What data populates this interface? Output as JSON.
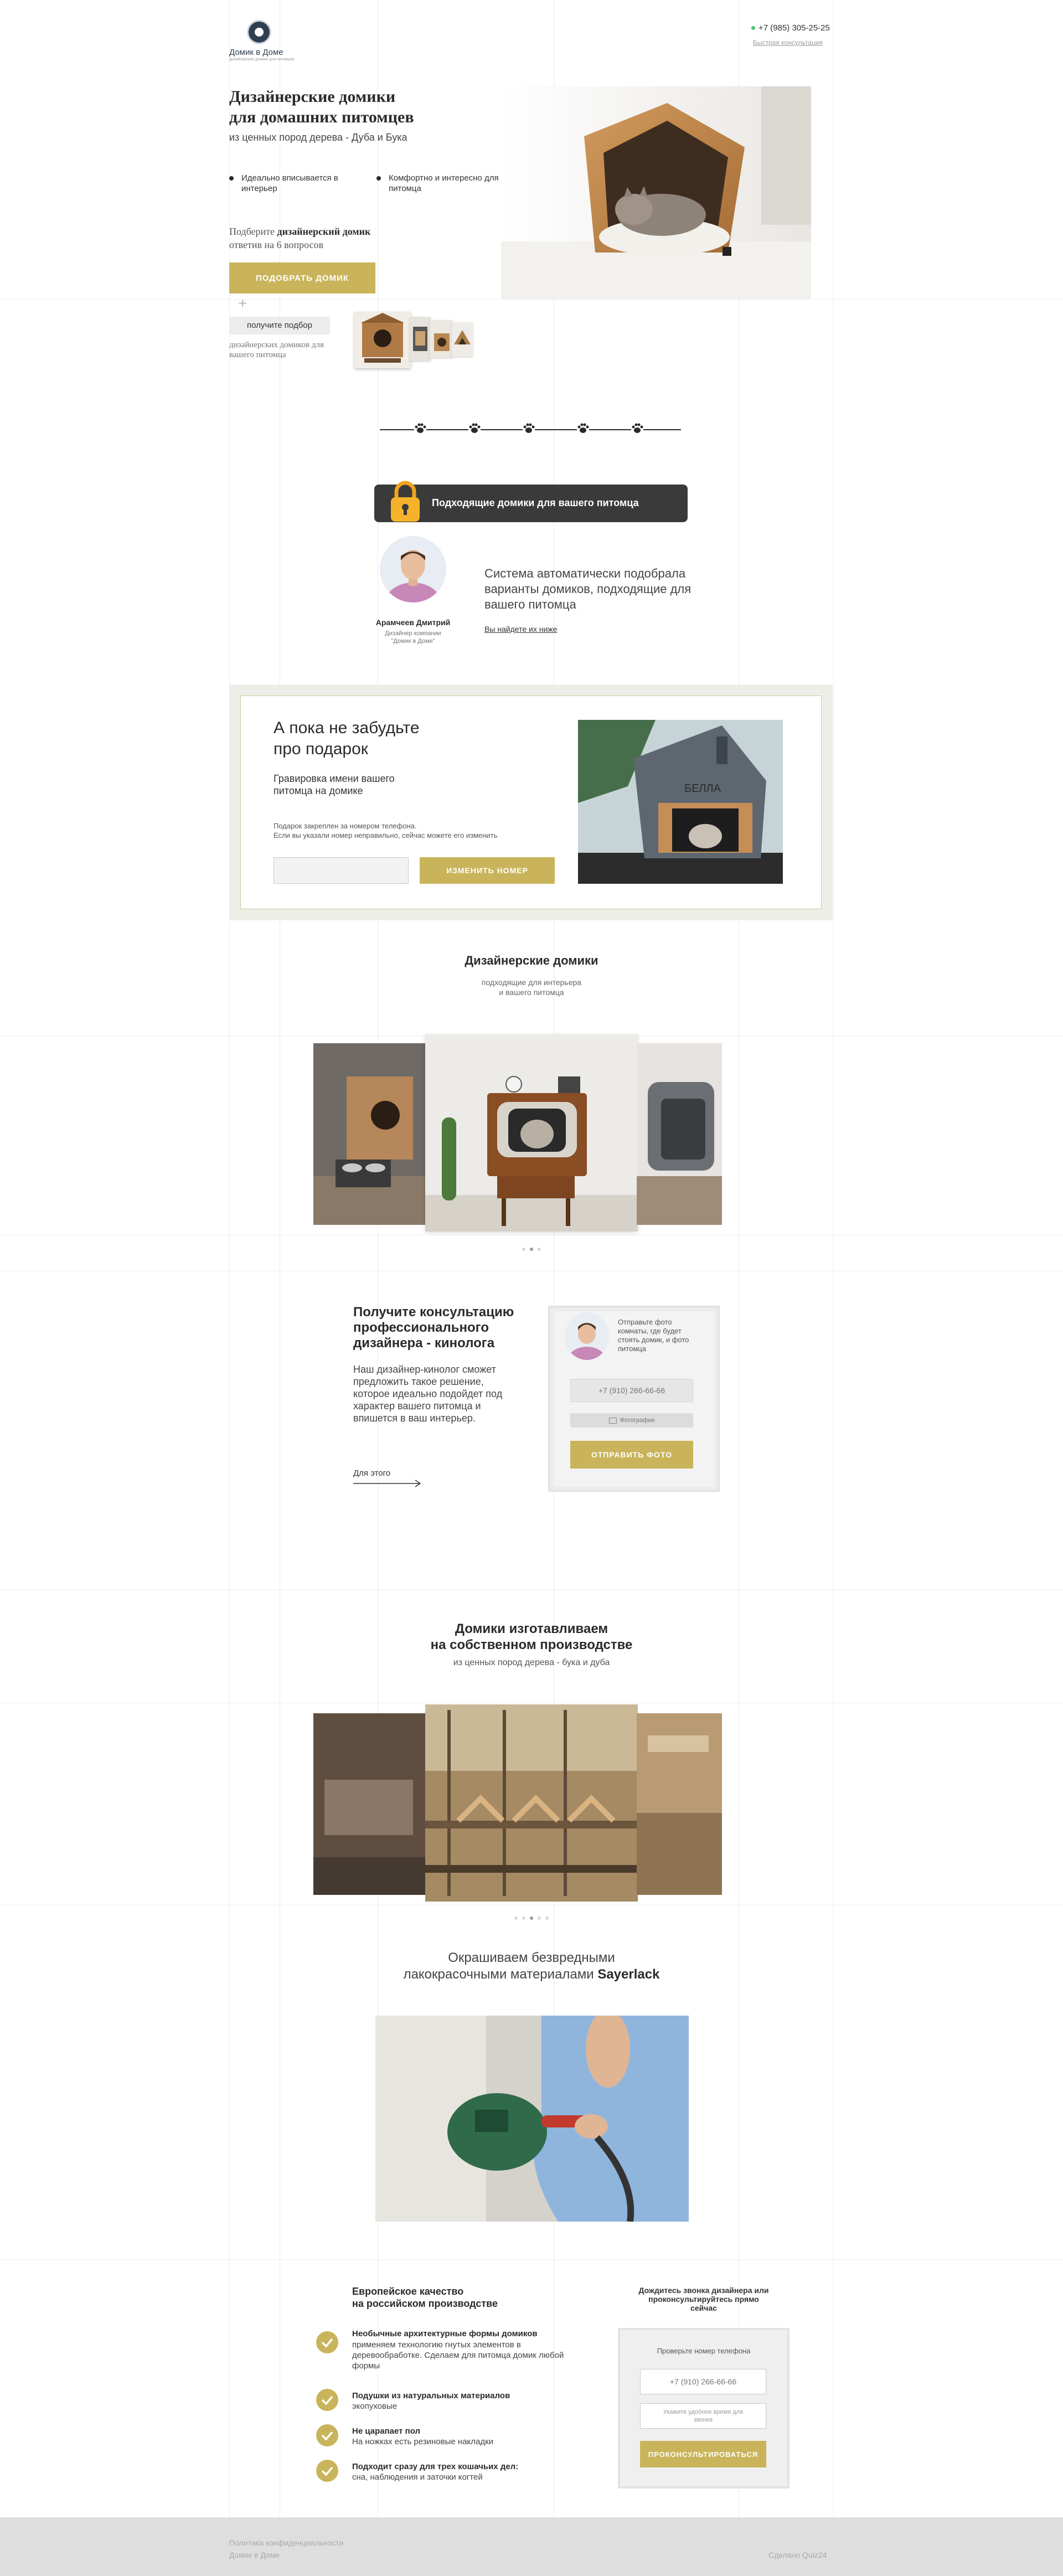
{
  "header": {
    "logo_name": "Домик в Доме",
    "logo_tagline": "дизайнерские домики для питомцев",
    "phone": "+7 (985) 305-25-25",
    "callback_link": "Быстрая консультация"
  },
  "hero": {
    "title_line1": "Дизайнерские домики",
    "title_line2": "для домашних питомцев",
    "subtitle": "из ценных пород дерева - Дуба и Бука",
    "feature1": "Идеально вписывается в интерьер",
    "feature2": "Комфортно и интересно для питомца",
    "quiz_line1_a": "Подберите ",
    "quiz_line1_b": "дизайнерский домик",
    "quiz_line2": "ответив на 6 вопросов",
    "cta_button": "ПОДОБРАТЬ ДОМИК",
    "plus": "+",
    "chip_label": "получите подбор",
    "chip_note": "дизайнерских домиков для вашего питомца"
  },
  "result": {
    "banner": "Подходящие домики для вашего питомца",
    "designer_name": "Арамчеев Дмитрий",
    "designer_role_line1": "Дизайнер компании",
    "designer_role_line2": "\"Домик в Доме\"",
    "system_text": "Система автоматически подобрала варианты домиков, подходящие для вашего питомца",
    "link_text": "Вы найдете их ниже"
  },
  "gift": {
    "title_line1": "А пока не забудьте",
    "title_line2": "про подарок",
    "subtitle_line1": "Гравировка имени вашего",
    "subtitle_line2": "питомца на домике",
    "note_line1": "Подарок закреплен за номером телефона.",
    "note_line2": "Если вы указали номер неправильно, сейчас можете его изменить",
    "phone_value": "",
    "change_button": "ИЗМЕНИТЬ НОМЕР",
    "house_name": "БЕЛЛА"
  },
  "designer_houses": {
    "title": "Дизайнерские домики",
    "subtitle_line1": "подходящие для интерьера",
    "subtitle_line2": "и вашего питомца"
  },
  "consult": {
    "title_line1": "Получите консультацию",
    "title_line2": "профессионального",
    "title_line3": "дизайнера - кинолога",
    "text": "Наш дизайнер-кинолог сможет предложить такое решение, которое идеально подойдет под характер вашего питомца и впишется в ваш интерьер.",
    "link": "Для этого",
    "card_text": "Отправьте фото комнаты, где будет стоять домик, и фото питомца",
    "phone_placeholder": "+7 (910) 266-66-66",
    "photo_label": "Фотографии",
    "send_button": "ОТПРАВИТЬ ФОТО"
  },
  "production": {
    "title_line1": "Домики изготавливаем",
    "title_line2": "на собственном производстве",
    "subtitle": "из ценных пород дерева - бука и дуба"
  },
  "paint": {
    "title_line1": "Окрашиваем безвредными",
    "title_line2_a": "лакокрасочными материалами ",
    "title_line2_b": "Sayerlack"
  },
  "quality": {
    "title_line1": "Европейское качество",
    "title_line2": "на российском производстве",
    "items": [
      {
        "bold": "Необычные архитектурные формы домиков",
        "text": "применяем технологию гнутых элементов в деревообработке. Сделаем для питомца домик любой формы"
      },
      {
        "bold": "Подушки из натуральных материалов",
        "text": "экопуховые"
      },
      {
        "bold": "Не царапает пол",
        "text": "На ножках есть резиновые накладки"
      },
      {
        "bold": "Подходит сразу для трех кошачьих дел:",
        "text": "сна, наблюдения и заточки когтей"
      }
    ],
    "form_title": "Дождитесь звонка дизайнера или проконсультируйтесь прямо сейчас",
    "form_label": "Проверьте номер телефона",
    "phone_placeholder": "+7 (910) 266-66-66",
    "time_placeholder": "Укажите удобное время для звонка",
    "consult_button": "ПРОКОНСУЛЬТИРОВАТЬСЯ"
  },
  "footer": {
    "privacy": "Политика конфиденциальности",
    "brand": "Домик в Доме",
    "made_by": "Сделано Quiz24"
  },
  "colors": {
    "accent": "#c9b45b",
    "dark": "#2f3f52",
    "footer_bg": "#dedede",
    "gift_bg": "#eeeee8"
  }
}
